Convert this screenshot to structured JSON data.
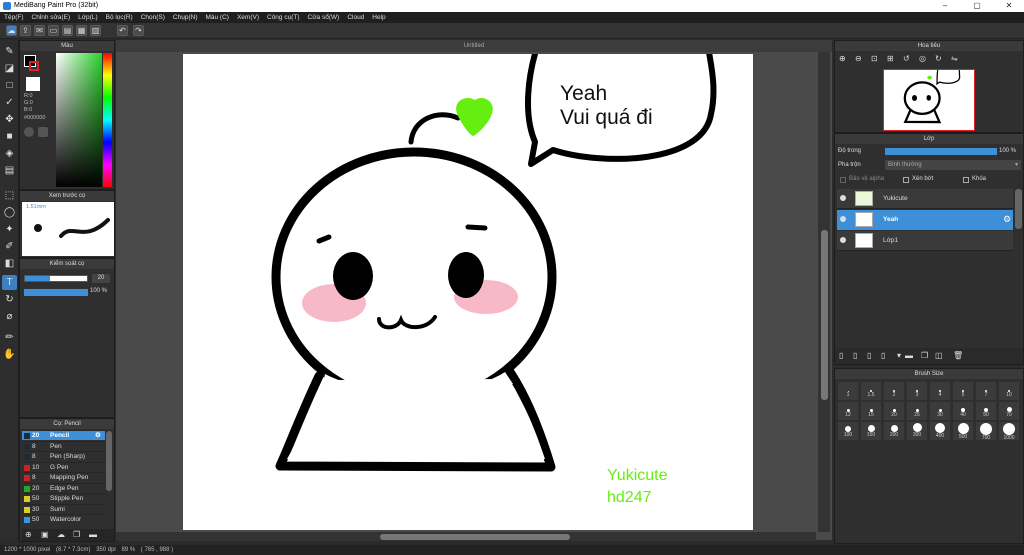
{
  "window": {
    "title": "MediBang Paint Pro (32bit)",
    "min": "–",
    "max": "▢",
    "close": "✕"
  },
  "menu": [
    "Tệp(F)",
    "Chỉnh sửa(E)",
    "Lớp(L)",
    "Bộ lọc(R)",
    "Chọn(S)",
    "Chụp(N)",
    "Màu (C)",
    "Xem(V)",
    "Công cụ(T)",
    "Cửa sổ(W)",
    "Cloud",
    "Help"
  ],
  "document": {
    "tab": "Untitled",
    "speech_line1": "Yeah",
    "speech_line2": "Vui quá đi",
    "sig_line1": "Yukicute",
    "sig_line2": "hd247"
  },
  "color_panel": {
    "title": "Màu",
    "r": "R:0",
    "g": "G:0",
    "b": "B:0",
    "hex": "#000000"
  },
  "brush_preview": {
    "title": "Xem trước cọ",
    "size": "1.51mm"
  },
  "brush_control": {
    "title": "Kiểm soát cọ",
    "size": "20",
    "opacity": "100 %"
  },
  "brush_list": {
    "title": "Cọ: Pencil",
    "items": [
      {
        "size": "20",
        "name": "Pencil",
        "color": "#1e2a3a",
        "selected": true
      },
      {
        "size": "8",
        "name": "Pen",
        "color": "#1e2a3a"
      },
      {
        "size": "8",
        "name": "Pen (Sharp)",
        "color": "#1e2a3a"
      },
      {
        "size": "10",
        "name": "G Pen",
        "color": "#cc2222"
      },
      {
        "size": "8",
        "name": "Mapping Pen",
        "color": "#cc2222"
      },
      {
        "size": "20",
        "name": "Edge Pen",
        "color": "#22aa22"
      },
      {
        "size": "50",
        "name": "Stipple Pen",
        "color": "#ddcc22"
      },
      {
        "size": "30",
        "name": "Sumi",
        "color": "#ddcc22"
      },
      {
        "size": "50",
        "name": "Watercolor",
        "color": "#3399dd"
      }
    ]
  },
  "navigator": {
    "title": "Hoa tiêu"
  },
  "layers": {
    "title": "Lớp",
    "opacity_label": "Độ trong",
    "opacity_value": "100 %",
    "blend_label": "Pha trộn",
    "blend_value": "Bình thường",
    "protect_alpha": "Bảo vệ alpha",
    "clipping": "Xén bớt",
    "lock": "Khóa",
    "items": [
      {
        "name": "Yukicute",
        "selected": false
      },
      {
        "name": "Yeah",
        "selected": true
      },
      {
        "name": "Lớp1",
        "selected": false
      }
    ]
  },
  "brush_size": {
    "title": "Brush Size",
    "values": [
      "1",
      "1.5",
      "2",
      "3",
      "4",
      "5",
      "7",
      "10",
      "12",
      "15",
      "20",
      "25",
      "30",
      "40",
      "50",
      "70",
      "100",
      "150",
      "200",
      "300",
      "400",
      "500",
      "700",
      "1000"
    ]
  },
  "status": {
    "size": "1200 * 1000 pixel",
    "cm": "(8.7 * 7.3cm)",
    "dpi": "350 dpi",
    "zoom": "89 %",
    "coords": "( 765 , 988 )"
  },
  "colors": {
    "accent": "#3d8fd8",
    "leaf": "#66ee11",
    "cheek": "#f7b8c8",
    "signature": "#66ee11"
  }
}
